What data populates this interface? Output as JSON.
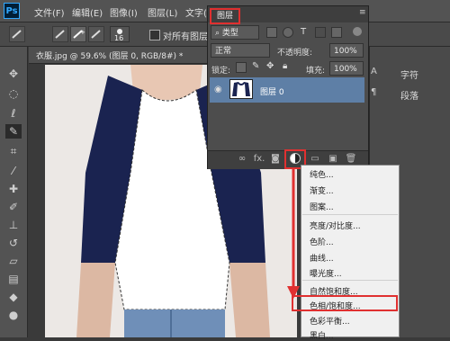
{
  "app": {
    "logo": "Ps"
  },
  "menubar": {
    "items": [
      "文件(F)",
      "编辑(E)",
      "图像(I)",
      "图层(L)",
      "文字(Y)"
    ]
  },
  "options_bar": {
    "brush_size": "16",
    "sample_all_layers_label": "对所有图层取样"
  },
  "document_tab": {
    "title": "衣服.jpg @ 59.6% (图层 0, RGB/8#) *",
    "close": "×"
  },
  "layers_panel": {
    "tab_label": "图层",
    "panel_menu": "≡",
    "filter_label": "类型",
    "blend_mode": "正常",
    "opacity_label": "不透明度:",
    "opacity_value": "100%",
    "lock_label": "锁定:",
    "fill_label": "填充:",
    "fill_value": "100%",
    "layers": [
      {
        "name": "图层 0",
        "visible": true,
        "selected": true
      }
    ],
    "bottom_icons": [
      "link-icon",
      "fx-icon",
      "mask-icon",
      "adjustment-icon",
      "folder-icon",
      "new-layer-icon",
      "trash-icon"
    ],
    "fx_label": "fx."
  },
  "right_panel": {
    "items": [
      "字符",
      "段落"
    ]
  },
  "adjustment_menu": {
    "items": [
      {
        "label": "纯色...",
        "highlighted": false
      },
      {
        "label": "渐变...",
        "highlighted": false
      },
      {
        "label": "图案...",
        "highlighted": false
      },
      {
        "label": "亮度/对比度...",
        "highlighted": false
      },
      {
        "label": "色阶...",
        "highlighted": false
      },
      {
        "label": "曲线...",
        "highlighted": false
      },
      {
        "label": "曝光度...",
        "highlighted": false
      },
      {
        "label": "自然饱和度...",
        "highlighted": false
      },
      {
        "label": "色相/饱和度...",
        "highlighted": true
      },
      {
        "label": "色彩平衡...",
        "highlighted": false
      },
      {
        "label": "黑白...",
        "highlighted": false
      }
    ]
  },
  "colors": {
    "accent_red": "#e03030",
    "ps_blue": "#31a8ff",
    "tshirt_sleeves": "#1a2350",
    "tshirt_body": "#ffffff",
    "layer_selected": "#5e7fa6"
  }
}
